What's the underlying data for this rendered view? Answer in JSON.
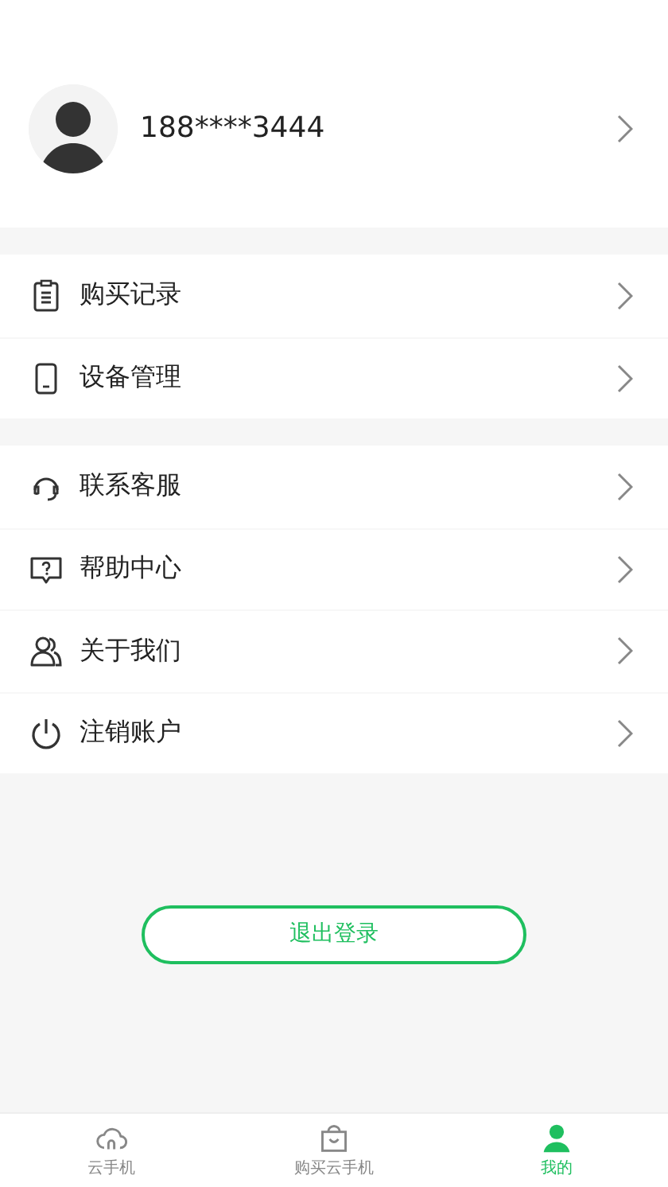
{
  "profile": {
    "phone": "188****3444"
  },
  "menu_groups": [
    {
      "items": [
        {
          "label": "购买记录"
        },
        {
          "label": "设备管理"
        }
      ]
    },
    {
      "items": [
        {
          "label": "联系客服"
        },
        {
          "label": "帮助中心"
        },
        {
          "label": "关于我们"
        },
        {
          "label": "注销账户"
        }
      ]
    }
  ],
  "logout_button": "退出登录",
  "tab_bar": [
    {
      "label": "云手机",
      "selected": false
    },
    {
      "label": "购买云手机",
      "selected": false
    },
    {
      "label": "我的",
      "selected": true
    }
  ]
}
